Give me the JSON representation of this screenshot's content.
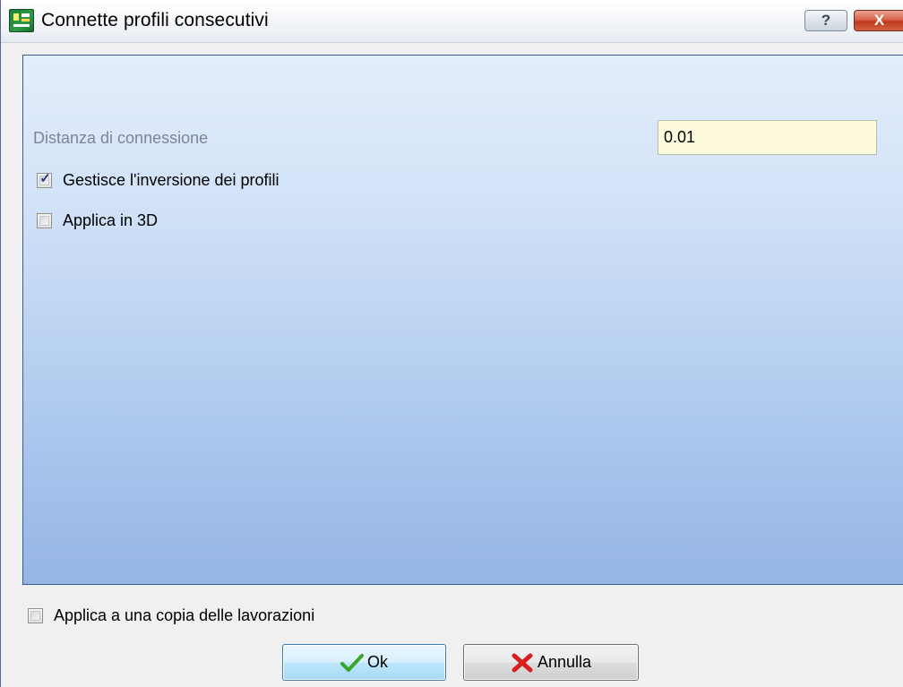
{
  "window": {
    "title": "Connette profili consecutivi",
    "help_glyph": "?",
    "close_glyph": "X"
  },
  "form": {
    "distance_label": "Distanza di connessione",
    "distance_value": "0.01",
    "manage_inversion_label": "Gestisce l'inversione dei profili",
    "manage_inversion_checked": true,
    "apply_3d_label": "Applica in 3D",
    "apply_3d_checked": false
  },
  "footer": {
    "apply_copy_label": "Applica a una copia delle lavorazioni",
    "apply_copy_checked": false,
    "ok_label": "Ok",
    "cancel_label": "Annulla"
  },
  "icons": {
    "app": "app-logo-icon",
    "help": "help-icon",
    "close": "close-icon",
    "ok": "green-check-icon",
    "cancel": "red-x-icon"
  },
  "colors": {
    "panel_top": "#e4eefb",
    "panel_bottom": "#95b5e6",
    "input_bg": "#fdfbdc",
    "ok_check": "#3aa52a",
    "cancel_x": "#d81e1e"
  }
}
